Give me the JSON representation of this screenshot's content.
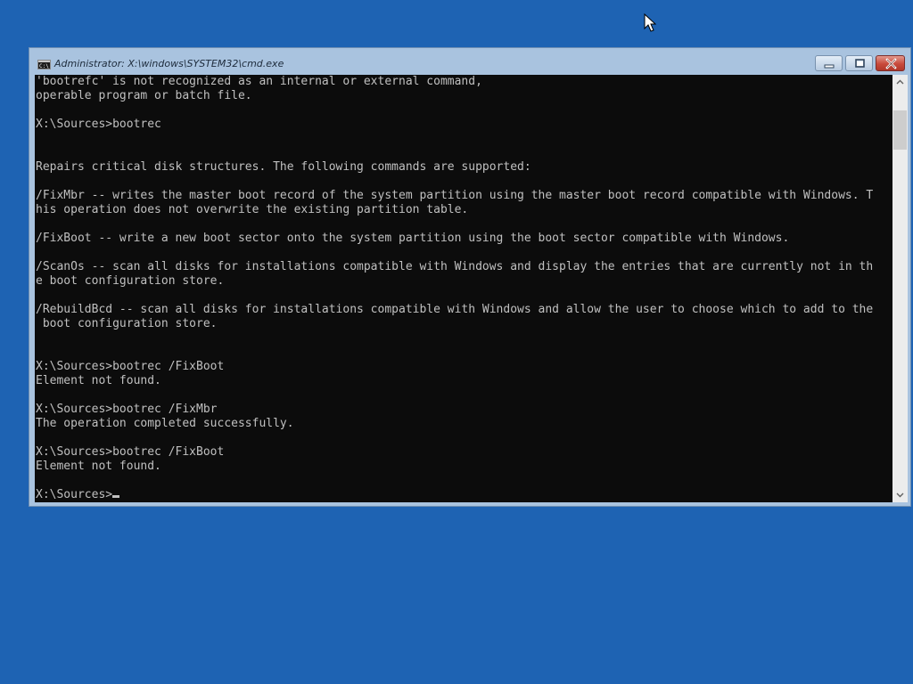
{
  "window": {
    "title": "Administrator: X:\\windows\\SYSTEM32\\cmd.exe",
    "controls": {
      "minimize_icon": "minimize-icon",
      "maximize_icon": "restore-icon",
      "close_icon": "close-icon"
    }
  },
  "console": {
    "lines": [
      "'bootrefc' is not recognized as an internal or external command,",
      "operable program or batch file.",
      "",
      "X:\\Sources>bootrec",
      "",
      "",
      "Repairs critical disk structures. The following commands are supported:",
      "",
      "/FixMbr -- writes the master boot record of the system partition using the master boot record compatible with Windows. T",
      "his operation does not overwrite the existing partition table.",
      "",
      "/FixBoot -- write a new boot sector onto the system partition using the boot sector compatible with Windows.",
      "",
      "/ScanOs -- scan all disks for installations compatible with Windows and display the entries that are currently not in th",
      "e boot configuration store.",
      "",
      "/RebuildBcd -- scan all disks for installations compatible with Windows and allow the user to choose which to add to the",
      " boot configuration store.",
      "",
      "",
      "X:\\Sources>bootrec /FixBoot",
      "Element not found.",
      "",
      "X:\\Sources>bootrec /FixMbr",
      "The operation completed successfully.",
      "",
      "X:\\Sources>bootrec /FixBoot",
      "Element not found.",
      ""
    ],
    "prompt": "X:\\Sources>"
  },
  "colors": {
    "desktop": "#1e63b3",
    "console_bg": "#0c0c0c",
    "console_fg": "#c0c0c0"
  }
}
